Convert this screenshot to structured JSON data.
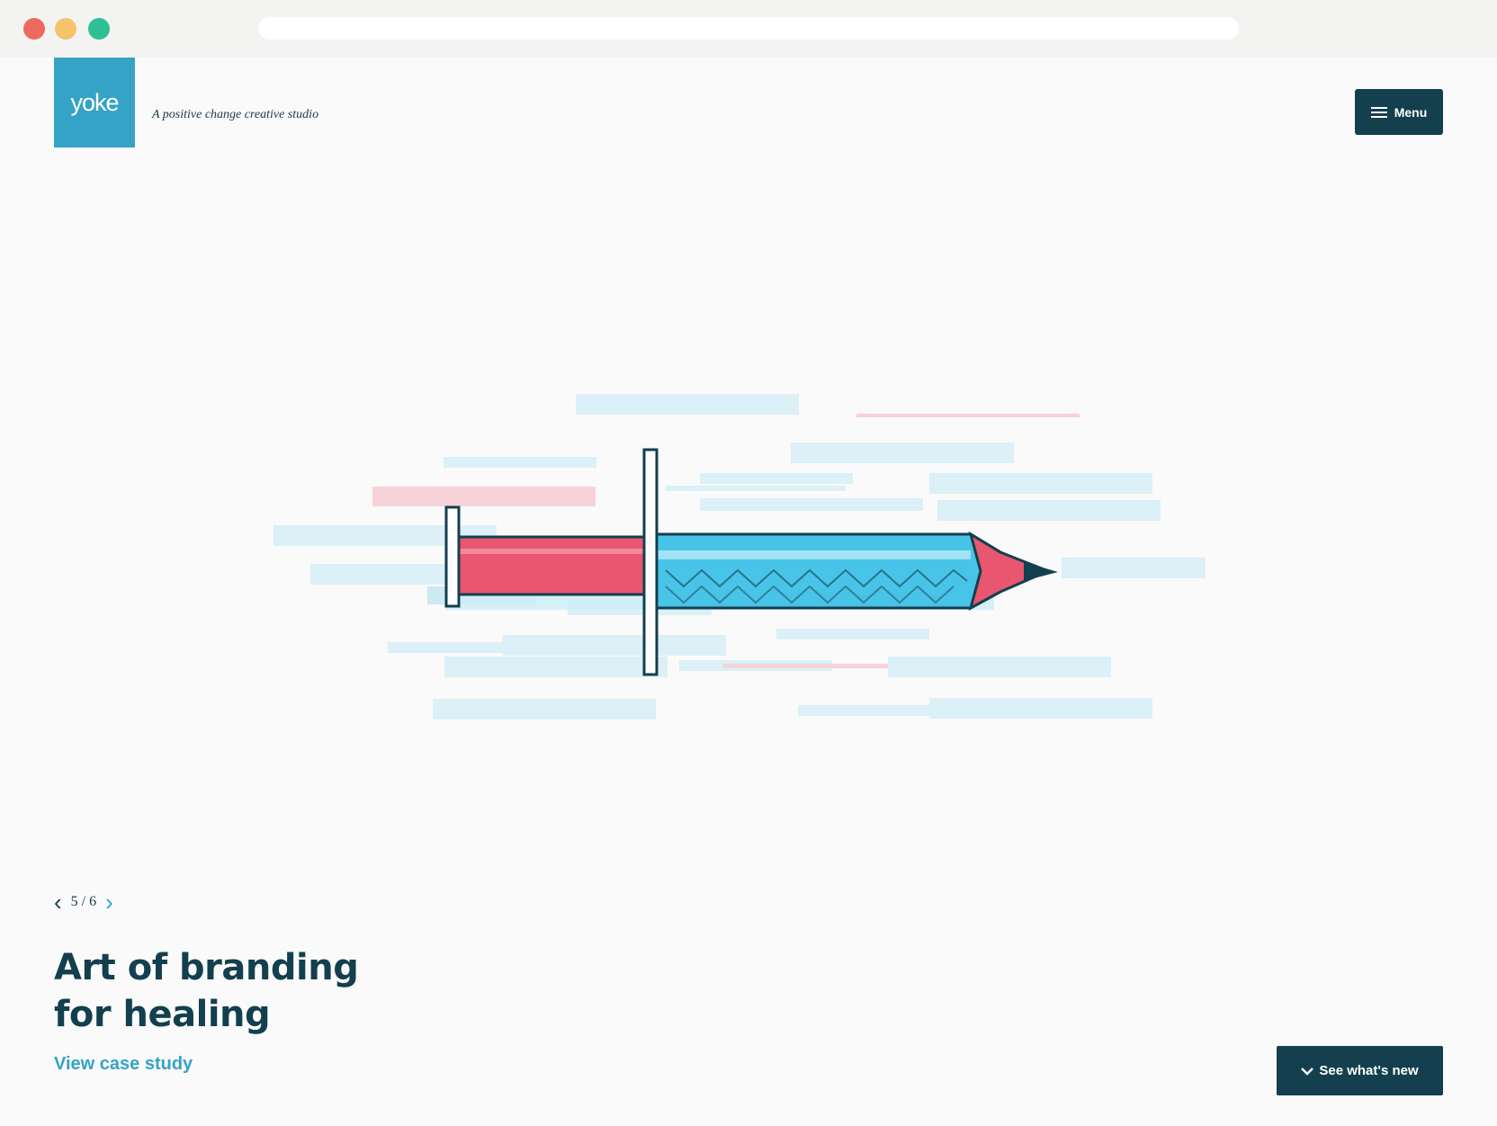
{
  "header": {
    "logo_text": "yoke",
    "tagline": "A positive change creative studio",
    "menu_label": "Menu"
  },
  "hero": {
    "illustration": "syringe-pencil-illustration"
  },
  "slider": {
    "counter": "5 / 6",
    "current": 5,
    "total": 6,
    "title_line1": "Art of branding",
    "title_line2": "for healing",
    "link_label": "View case study"
  },
  "footer": {
    "whats_new_label": "See what's new"
  },
  "colors": {
    "accent": "#35a3c6",
    "navy": "#133f4e",
    "pink": "#e8566f",
    "background": "#fafafa"
  }
}
